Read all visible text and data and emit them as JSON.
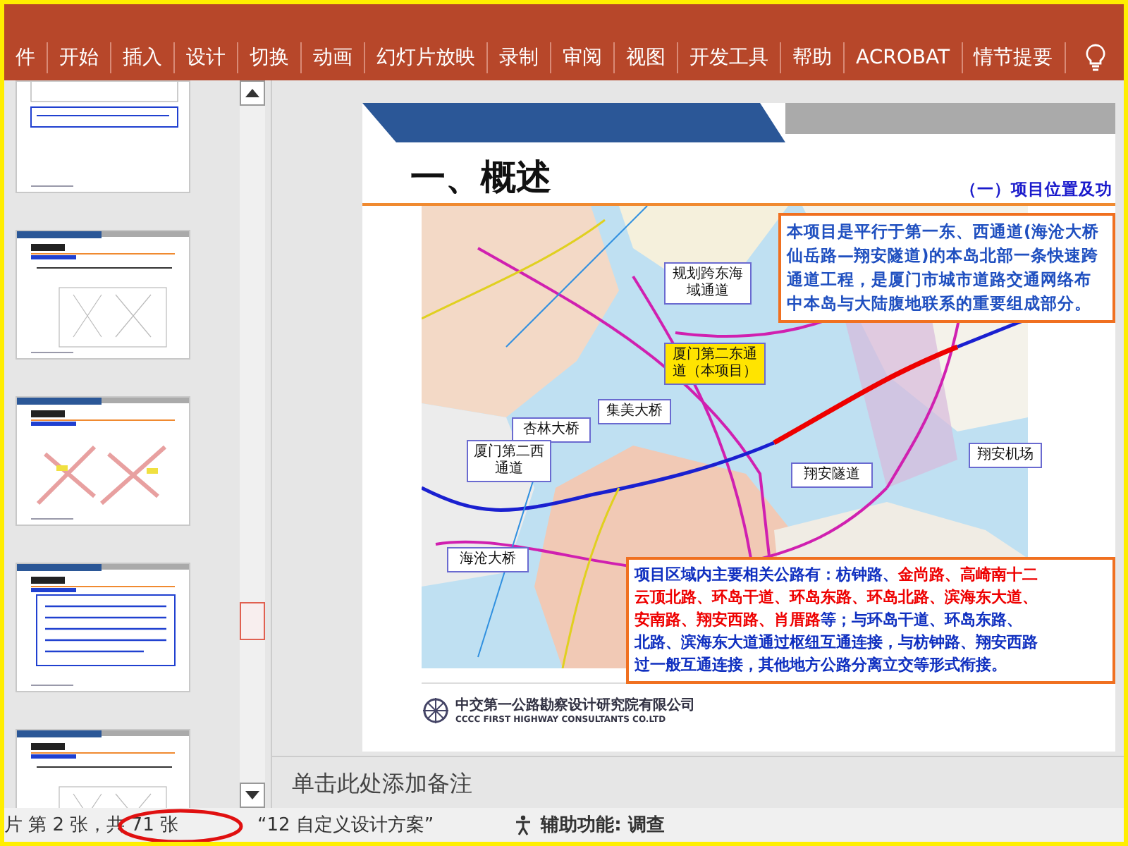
{
  "ribbon": {
    "tabs": [
      {
        "label": "件",
        "selected": false
      },
      {
        "label": "开始",
        "selected": false
      },
      {
        "label": "插入",
        "selected": false
      },
      {
        "label": "设计",
        "selected": false
      },
      {
        "label": "切换",
        "selected": false
      },
      {
        "label": "动画",
        "selected": false
      },
      {
        "label": "幻灯片放映",
        "selected": false
      },
      {
        "label": "录制",
        "selected": false
      },
      {
        "label": "审阅",
        "selected": false
      },
      {
        "label": "视图",
        "selected": false
      },
      {
        "label": "开发工具",
        "selected": false
      },
      {
        "label": "帮助",
        "selected": false
      },
      {
        "label": "ACROBAT",
        "selected": false
      },
      {
        "label": "情节提要",
        "selected": false
      }
    ]
  },
  "thumbnails": [
    {
      "kind": "table"
    },
    {
      "kind": "diagram"
    },
    {
      "kind": "photos"
    },
    {
      "kind": "textbox"
    },
    {
      "kind": "diagram"
    }
  ],
  "slide": {
    "title": "一、概述",
    "subtitle": "（一）项目位置及功",
    "intro_lines": [
      "本项目是平行于第一东、西通道(海沧大桥",
      "仙岳路—翔安隧道)的本岛北部一条快速跨",
      "通道工程，是厦门市城市道路交通网络布",
      "中本岛与大陆腹地联系的重要组成部分。"
    ],
    "map_labels": [
      {
        "text": "规划跨东海域通道",
        "kind": "plain"
      },
      {
        "text": "厦门第二东通道（本项目）",
        "kind": "project"
      },
      {
        "text": "集美大桥",
        "kind": "plain"
      },
      {
        "text": "杏林大桥",
        "kind": "plain"
      },
      {
        "text": "厦门第二西通道",
        "kind": "plain"
      },
      {
        "text": "翔安隧道",
        "kind": "plain"
      },
      {
        "text": "翔安机场",
        "kind": "plain"
      },
      {
        "text": "海沧大桥",
        "kind": "plain"
      }
    ],
    "roads_lines": [
      [
        {
          "text": "项目区域内主要相关公路有：枋钟路、",
          "highlight": false
        },
        {
          "text": "金尚路、高崎南十二",
          "highlight": true
        }
      ],
      [
        {
          "text": "云顶北路、环岛干道、环岛东路、环岛北路、滨海东大道、",
          "highlight": true
        }
      ],
      [
        {
          "text": "安南路、翔安西路、肖厝路",
          "highlight": true
        },
        {
          "text": "等；与环岛干道、环岛东路、",
          "highlight": false
        }
      ],
      [
        {
          "text": "北路、滨海东大道通过枢纽互通连接，与枋钟路、翔安西路",
          "highlight": false
        }
      ],
      [
        {
          "text": "过一般互通连接，其他地方公路分离立交等形式衔接。",
          "highlight": false
        }
      ]
    ],
    "footer_cn": "中交第一公路勘察设计研究院有限公司",
    "footer_en": "CCCC FIRST HIGHWAY CONSULTANTS CO.LTD"
  },
  "notes": {
    "placeholder": "单击此处添加备注"
  },
  "status_bar": {
    "slide_count": "片 第 2 张，共 71 张",
    "theme": "“12  自定义设计方案”",
    "accessibility": "辅助功能: 调查"
  }
}
